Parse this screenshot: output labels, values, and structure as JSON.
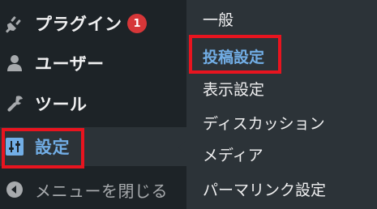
{
  "sidebar": {
    "items": [
      {
        "label": "プラグイン",
        "icon": "plugin-icon",
        "badge": "1"
      },
      {
        "label": "ユーザー",
        "icon": "user-icon"
      },
      {
        "label": "ツール",
        "icon": "wrench-icon"
      },
      {
        "label": "設定",
        "icon": "settings-sliders-icon",
        "active": true
      },
      {
        "label": "メニューを閉じる",
        "icon": "collapse-arrow-icon"
      }
    ]
  },
  "submenu": {
    "items": [
      {
        "label": "一般"
      },
      {
        "label": "投稿設定",
        "current": true
      },
      {
        "label": "表示設定"
      },
      {
        "label": "ディスカッション"
      },
      {
        "label": "メディア"
      },
      {
        "label": "パーマリンク設定"
      }
    ]
  },
  "colors": {
    "sidebar_bg": "#1d2327",
    "submenu_bg": "#2c3338",
    "accent": "#72aee6",
    "badge": "#d63638",
    "highlight": "#e8141f"
  }
}
